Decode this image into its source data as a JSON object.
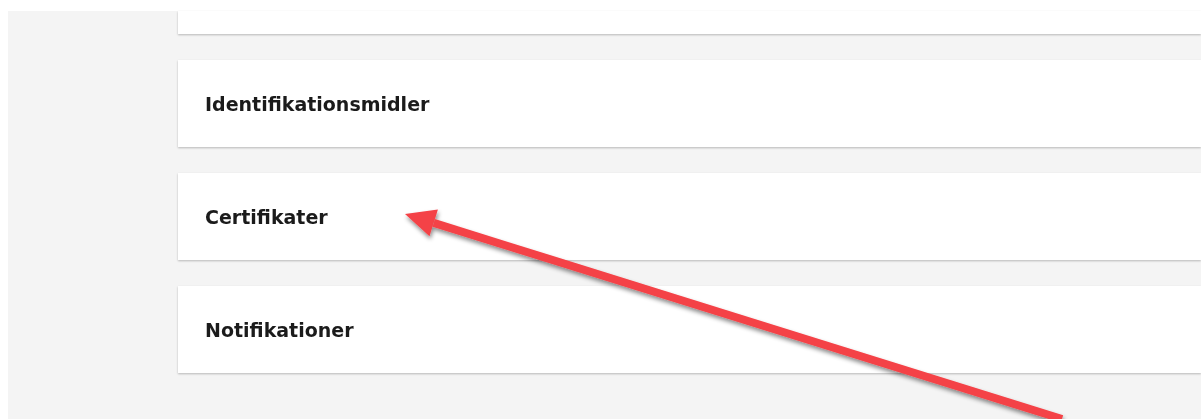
{
  "cards": [
    {
      "kind": "cut"
    },
    {
      "kind": "section",
      "title": "Identifikationsmidler"
    },
    {
      "kind": "section",
      "title": "Certifikater"
    },
    {
      "kind": "section",
      "title": "Notifikationer"
    }
  ]
}
